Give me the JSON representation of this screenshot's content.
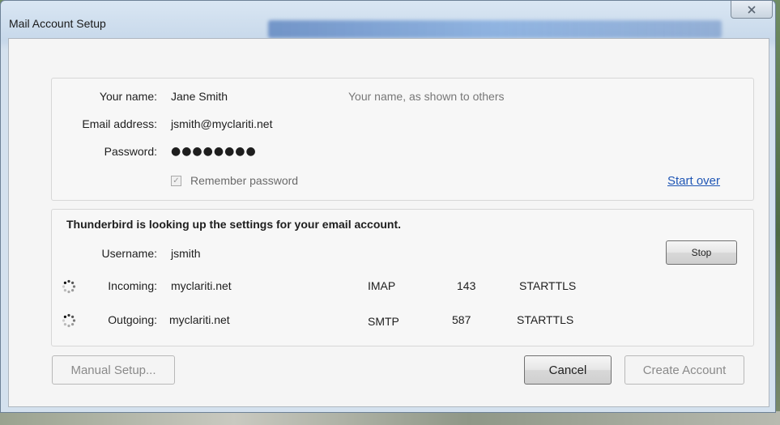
{
  "window": {
    "title": "Mail Account Setup"
  },
  "identity": {
    "name_label": "Your name:",
    "name_value": "Jane Smith",
    "name_hint": "Your name, as shown to others",
    "email_label": "Email address:",
    "email_value": "jsmith@myclariti.net",
    "password_label": "Password:",
    "password_value": "●●●●●●●●",
    "remember_label": "Remember password",
    "remember_checked": true,
    "start_over": "Start over"
  },
  "lookup": {
    "status": "Thunderbird is looking up the settings for your email account.",
    "username_label": "Username:",
    "username_value": "jsmith",
    "stop_label": "Stop",
    "incoming": {
      "label": "Incoming:",
      "server": "myclariti.net",
      "protocol": "IMAP",
      "port": "143",
      "security": "STARTTLS"
    },
    "outgoing": {
      "label": "Outgoing:",
      "server": "myclariti.net",
      "protocol": "SMTP",
      "port": "587",
      "security": "STARTTLS"
    }
  },
  "footer": {
    "manual_setup": "Manual Setup...",
    "cancel": "Cancel",
    "create_account": "Create Account"
  },
  "colors": {
    "link": "#1f56b5",
    "hint": "#777777"
  },
  "icons": {
    "close": "close-icon",
    "spinner": "loading-spinner-icon",
    "check": "checkmark-icon"
  }
}
